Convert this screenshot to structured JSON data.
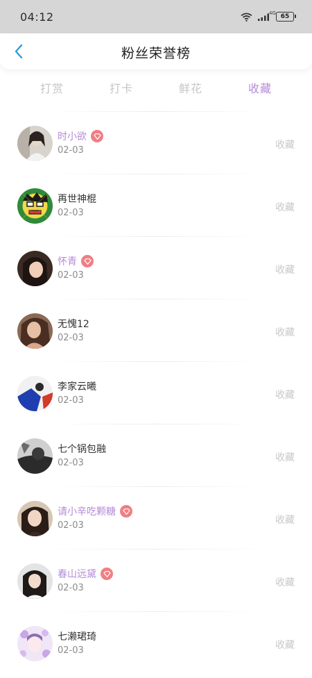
{
  "status_bar": {
    "time": "04:12",
    "network": "4G",
    "battery": "65"
  },
  "header": {
    "title": "粉丝荣誉榜",
    "back_icon": "chevron-left-icon"
  },
  "tabs": [
    {
      "label": "打赏",
      "active": false
    },
    {
      "label": "打卡",
      "active": false
    },
    {
      "label": "鲜花",
      "active": false
    },
    {
      "label": "收藏",
      "active": true
    }
  ],
  "colors": {
    "accent": "#b58ad6",
    "badge": "#f07e84",
    "muted": "#c8c8c8"
  },
  "fans": [
    {
      "name": "时小欲",
      "date": "02-03",
      "action": "收藏",
      "vip": true
    },
    {
      "name": "再世神棍",
      "date": "02-03",
      "action": "收藏",
      "vip": false
    },
    {
      "name": "怀青",
      "date": "02-03",
      "action": "收藏",
      "vip": true
    },
    {
      "name": "无愧12",
      "date": "02-03",
      "action": "收藏",
      "vip": false
    },
    {
      "name": "李家云曦",
      "date": "02-03",
      "action": "收藏",
      "vip": false
    },
    {
      "name": "七个锅包融",
      "date": "02-03",
      "action": "收藏",
      "vip": false
    },
    {
      "name": "请小辛吃颗糖",
      "date": "02-03",
      "action": "收藏",
      "vip": true
    },
    {
      "name": "春山远黛",
      "date": "02-03",
      "action": "收藏",
      "vip": true
    },
    {
      "name": "七濑珺琦",
      "date": "02-03",
      "action": "收藏",
      "vip": false
    }
  ]
}
